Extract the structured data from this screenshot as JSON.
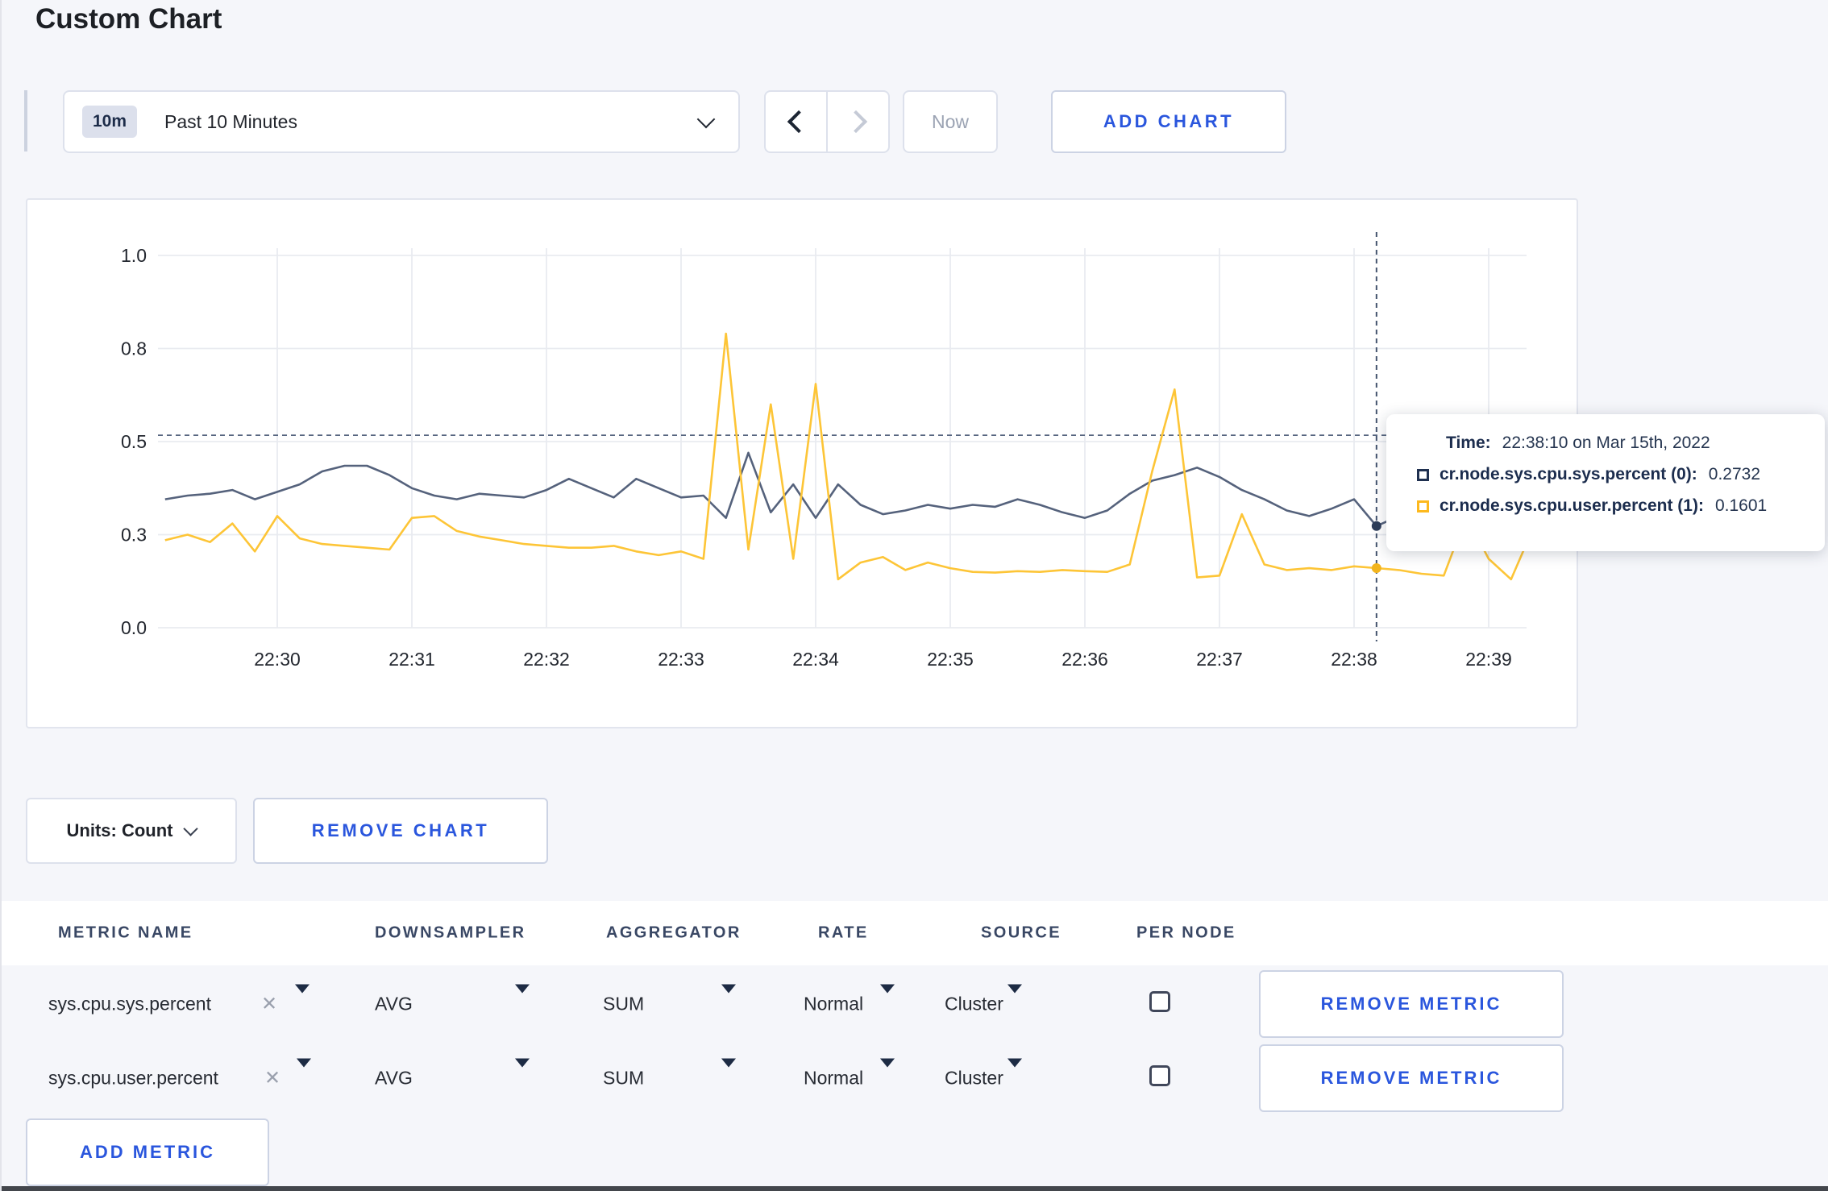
{
  "page": {
    "title": "Custom Chart"
  },
  "toolbar": {
    "time_window_badge": "10m",
    "time_window_label": "Past 10 Minutes",
    "now_label": "Now",
    "add_chart_label": "ADD CHART"
  },
  "chart_data": {
    "type": "line",
    "x_axis": {
      "tick_labels": [
        "22:30",
        "22:31",
        "22:32",
        "22:33",
        "22:34",
        "22:35",
        "22:36",
        "22:37",
        "22:38",
        "22:39"
      ],
      "start_time": "22:29:10",
      "interval_seconds": 10
    },
    "y_axis": {
      "tick_values": [
        0,
        0.25,
        0.5,
        0.75,
        1.0
      ],
      "tick_labels": [
        "0.0",
        "0.3",
        "0.5",
        "0.8",
        "1.0"
      ],
      "range": [
        0,
        1
      ]
    },
    "grid": true,
    "legend_position": "none",
    "series": [
      {
        "name": "cr.node.sys.cpu.sys.percent (0)",
        "color": "#55627c",
        "values": [
          0.345,
          0.355,
          0.36,
          0.37,
          0.345,
          0.365,
          0.385,
          0.42,
          0.435,
          0.435,
          0.41,
          0.375,
          0.355,
          0.345,
          0.36,
          0.355,
          0.35,
          0.37,
          0.4,
          0.375,
          0.35,
          0.4,
          0.375,
          0.35,
          0.355,
          0.295,
          0.47,
          0.31,
          0.385,
          0.295,
          0.385,
          0.33,
          0.305,
          0.315,
          0.33,
          0.32,
          0.33,
          0.325,
          0.345,
          0.33,
          0.31,
          0.295,
          0.315,
          0.36,
          0.395,
          0.41,
          0.43,
          0.405,
          0.37,
          0.345,
          0.315,
          0.3,
          0.32,
          0.345,
          0.2732,
          0.3,
          0.315,
          0.3,
          0.32,
          0.315,
          0.3,
          0.32
        ]
      },
      {
        "name": "cr.node.sys.cpu.user.percent (1)",
        "color": "#fdc537",
        "values": [
          0.235,
          0.25,
          0.23,
          0.28,
          0.205,
          0.3,
          0.24,
          0.225,
          0.22,
          0.215,
          0.21,
          0.295,
          0.3,
          0.26,
          0.245,
          0.235,
          0.225,
          0.22,
          0.215,
          0.215,
          0.22,
          0.205,
          0.195,
          0.205,
          0.185,
          0.79,
          0.21,
          0.6,
          0.185,
          0.655,
          0.13,
          0.175,
          0.19,
          0.155,
          0.175,
          0.16,
          0.15,
          0.148,
          0.152,
          0.15,
          0.155,
          0.152,
          0.15,
          0.17,
          0.42,
          0.64,
          0.135,
          0.14,
          0.305,
          0.17,
          0.155,
          0.16,
          0.155,
          0.165,
          0.1601,
          0.155,
          0.145,
          0.14,
          0.3,
          0.185,
          0.13,
          0.27
        ]
      }
    ],
    "crosshair": {
      "index": 54,
      "time": "22:38:10",
      "horizontal_value": 0.517
    }
  },
  "tooltip": {
    "time_label": "Time:",
    "time_value": "22:38:10 on Mar 15th, 2022",
    "rows": [
      {
        "label": "cr.node.sys.cpu.sys.percent (0):",
        "value": "0.2732",
        "color": "#1f3050"
      },
      {
        "label": "cr.node.sys.cpu.user.percent (1):",
        "value": "0.1601",
        "color": "#fdb91e"
      }
    ]
  },
  "chart_controls": {
    "units_label": "Units: Count",
    "remove_chart_label": "REMOVE CHART"
  },
  "metrics_table": {
    "headers": [
      "METRIC NAME",
      "DOWNSAMPLER",
      "AGGREGATOR",
      "RATE",
      "SOURCE",
      "PER NODE"
    ],
    "clear_icon": "✕",
    "rows": [
      {
        "metric_name": "sys.cpu.sys.percent",
        "downsampler": "AVG",
        "aggregator": "SUM",
        "rate": "Normal",
        "source": "Cluster",
        "per_node_checked": false,
        "remove_label": "REMOVE METRIC"
      },
      {
        "metric_name": "sys.cpu.user.percent",
        "downsampler": "AVG",
        "aggregator": "SUM",
        "rate": "Normal",
        "source": "Cluster",
        "per_node_checked": false,
        "remove_label": "REMOVE METRIC"
      }
    ],
    "add_metric_label": "ADD METRIC"
  }
}
